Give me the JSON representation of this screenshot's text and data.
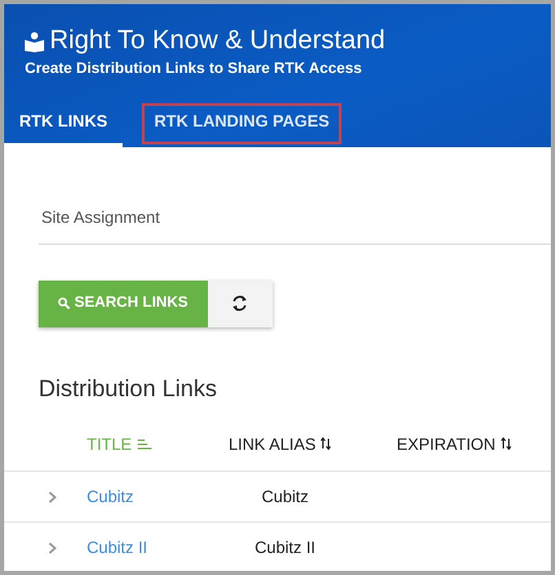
{
  "header": {
    "title": "Right To Know & Understand",
    "subtitle": "Create Distribution Links to Share RTK Access"
  },
  "tabs": [
    {
      "label": "RTK LINKS",
      "selected": true,
      "highlighted": false
    },
    {
      "label": "RTK LANDING PAGES",
      "selected": false,
      "highlighted": true
    }
  ],
  "site_field": {
    "placeholder": "Site Assignment"
  },
  "buttons": {
    "search": "SEARCH LINKS"
  },
  "section_title": "Distribution Links",
  "table": {
    "columns": [
      {
        "label": "TITLE",
        "sorted": true
      },
      {
        "label": "LINK ALIAS",
        "sorted": false
      },
      {
        "label": "EXPIRATION",
        "sorted": false
      }
    ],
    "rows": [
      {
        "title": "Cubitz",
        "alias": "Cubitz"
      },
      {
        "title": "Cubitz II",
        "alias": "Cubitz II"
      }
    ]
  }
}
